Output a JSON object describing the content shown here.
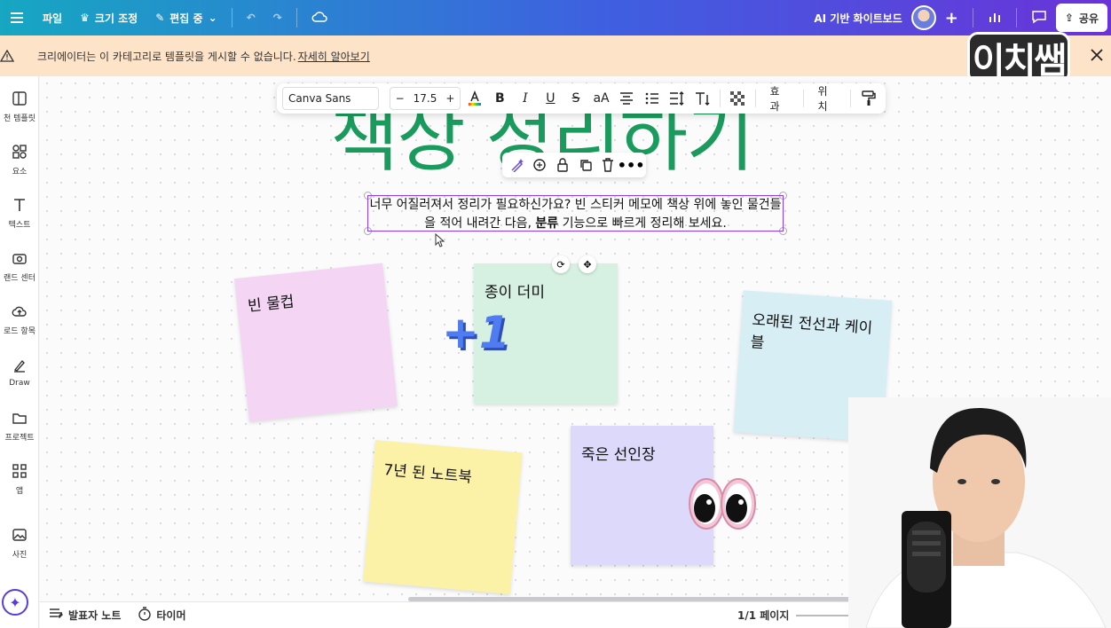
{
  "topbar": {
    "menu_icon": "hamburger-icon",
    "file_label": "파일",
    "resize_label": "크기 조정",
    "editing_label": "편집 중",
    "doc_title": "AI 기반 화이트보드",
    "share_label": "공유"
  },
  "banner": {
    "message": "크리에이터는 이 카테고리로 템플릿을 게시할 수 없습니다.",
    "link": "자세히 알아보기"
  },
  "watermark": "이치쌤",
  "sidebar": {
    "items": [
      {
        "label": "천 템플릿",
        "icon": "template-icon"
      },
      {
        "label": "요소",
        "icon": "elements-icon"
      },
      {
        "label": "텍스트",
        "icon": "text-icon"
      },
      {
        "label": "랜드 센터",
        "icon": "brand-icon"
      },
      {
        "label": "로드 항목",
        "icon": "upload-icon"
      },
      {
        "label": "Draw",
        "icon": "draw-icon"
      },
      {
        "label": "프로젝트",
        "icon": "folder-icon"
      },
      {
        "label": "앱",
        "icon": "apps-icon"
      },
      {
        "label": "사진",
        "icon": "photo-icon"
      }
    ]
  },
  "toolbar": {
    "font": "Canva Sans",
    "size": "17.5",
    "bold": "B",
    "italic": "I",
    "underline": "U",
    "strike": "S",
    "case": "aA",
    "effects": "효과",
    "position": "위치"
  },
  "canvas": {
    "title": "책상 정리하기",
    "instruction_part1": "너무 어질러져서 정리가 필요하신가요? 빈 스티커 메모에 책상 위에 놓인 물건들을 적어 내려간 다음, ",
    "instruction_bold": "분류",
    "instruction_part2": " 기능으로 빠르게 정리해 보세요.",
    "notes": {
      "pink": "빈 물컵",
      "green": "종이 더미",
      "blue": "오래된 전선과 케이블",
      "yellow": "7년 된 노트북",
      "purple": "죽은 선인장"
    },
    "sticker_text": "+1"
  },
  "bottombar": {
    "presenter_notes": "발표자 노트",
    "timer": "타이머",
    "pages": "1/1 페이지"
  },
  "colors": {
    "title_green": "#1a9a5c",
    "selection": "#8b3dff",
    "banner_bg": "#fde3c8"
  }
}
